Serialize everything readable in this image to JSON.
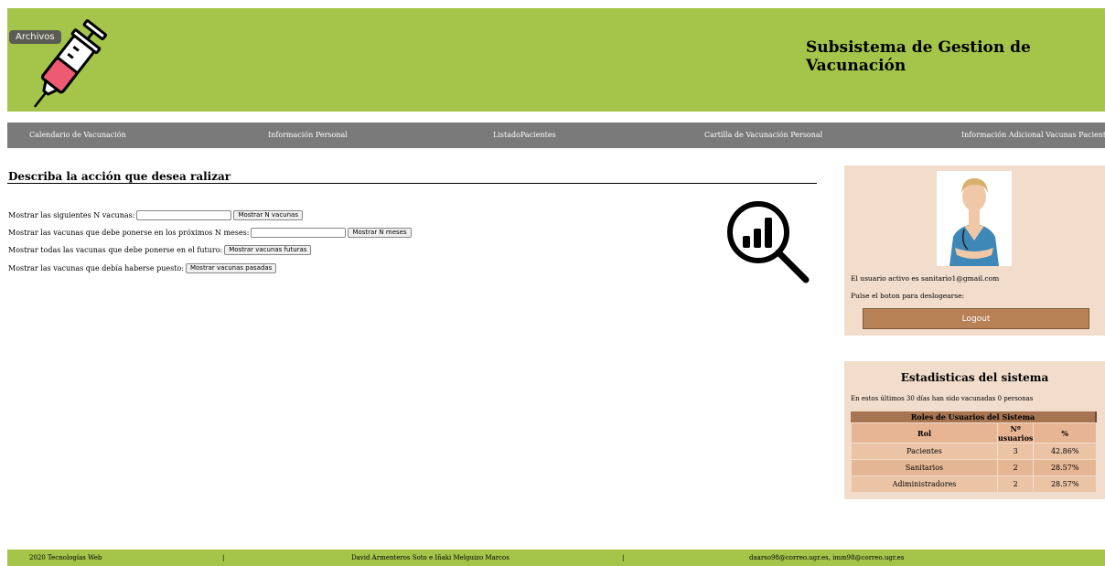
{
  "header": {
    "archivos_label": "Archivos",
    "site_title": "Subsistema de Gestion de Vacunación",
    "bg_color": "#a4c44a"
  },
  "nav": {
    "items": [
      {
        "label": "Calendario de Vacunación"
      },
      {
        "label": "Información Personal"
      },
      {
        "label": "ListadoPacientes"
      },
      {
        "label": "Cartilla de Vacunación Personal"
      },
      {
        "label": "Información Adicional Vacunas Paciente"
      }
    ]
  },
  "main": {
    "title": "Describa la acción que desea ralizar",
    "rows": [
      {
        "label": "Mostrar las siguientes N vacunas:",
        "input_value": "",
        "button": "Mostrar N vacunas"
      },
      {
        "label": "Mostrar las vacunas que debe ponerse en los próximos N meses:",
        "input_value": "",
        "button": "Mostrar N meses"
      },
      {
        "label": "Mostrar todas las vacunas que debe ponerse en el futuro:",
        "button": "Mostrar vacunas futuras"
      },
      {
        "label": "Mostrar las vacunas que debía haberse puesto:",
        "button": "Mostrar vacunas pasadas"
      }
    ],
    "graphic_icon": "analytics-magnifier-icon"
  },
  "user_panel": {
    "active_user_text": "El usuario activo es sanitario1@gmail.com",
    "logout_prompt": "Pulse el boton para deslogearse:",
    "logout_button": "Logout"
  },
  "stats": {
    "title": "Estadisticas del sistema",
    "vaccinated_text": "En estos últimos 30 días han sido vacunadas 0 personas",
    "table": {
      "caption": "Roles de Usuarios del Sistema",
      "headers": [
        "Rol",
        "Nº usuarios",
        "%"
      ],
      "rows": [
        [
          "Pacientes",
          "3",
          "42.86%"
        ],
        [
          "Sanitarios",
          "2",
          "28.57%"
        ],
        [
          "Adiministradores",
          "2",
          "28.57%"
        ]
      ]
    }
  },
  "footer": {
    "year_label": "2020 Tecnologías Web",
    "sep1": "|",
    "authors": "David Armenteros Soto e Iñaki Melguizo Marcos",
    "sep2": "|",
    "emails": "daarso98@correo.ugr.es, imm98@correo.ugr.es"
  }
}
